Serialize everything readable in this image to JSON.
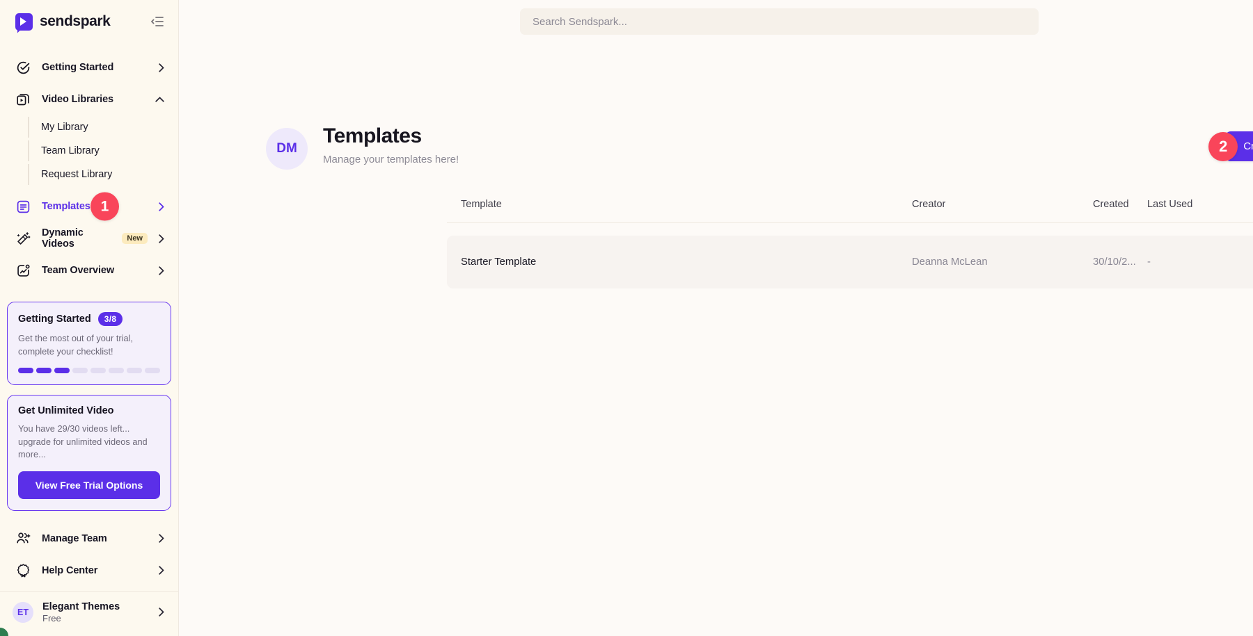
{
  "brand": {
    "name": "sendspark",
    "logo_icon": "sendspark-logo",
    "collapse_icon": "collapse-sidebar-icon"
  },
  "colors": {
    "accent": "#5b2fe8",
    "sidebar_bg": "#fdf9ef",
    "main_bg": "#fdfaf7",
    "badge_red": "#f9455a",
    "row_bg": "#f7f3f0",
    "new_badge_bg": "#fcebbe"
  },
  "search": {
    "placeholder": "Search Sendspark...",
    "value": ""
  },
  "sidebar": {
    "items": [
      {
        "label": "Getting Started",
        "icon": "check-circle-icon",
        "chevron": "chevron-right-icon"
      },
      {
        "label": "Video Libraries",
        "icon": "video-library-icon",
        "chevron": "chevron-up-icon"
      },
      {
        "label": "Templates",
        "icon": "document-lines-icon",
        "chevron": "chevron-right-icon",
        "badge": "1"
      },
      {
        "label": "Dynamic Videos",
        "icon": "magic-wand-icon",
        "chevron": "chevron-right-icon",
        "tag": "New"
      },
      {
        "label": "Team Overview",
        "icon": "chart-photo-icon",
        "chevron": "chevron-right-icon"
      }
    ],
    "sub_items": [
      {
        "label": "My Library"
      },
      {
        "label": "Team Library"
      },
      {
        "label": "Request Library"
      }
    ],
    "getting_started_card": {
      "title": "Getting Started",
      "pill": "3/8",
      "description": "Get the most out of your trial, complete your checklist!",
      "steps_total": 8,
      "steps_done": 3
    },
    "trial_card": {
      "title": "Get Unlimited Video",
      "description": "You have 29/30 videos left... upgrade for unlimited videos and more...",
      "button": "View Free Trial Options"
    },
    "bottom_items": [
      {
        "label": "Manage Team",
        "icon": "users-add-icon",
        "chevron": "chevron-right-icon"
      },
      {
        "label": "Help Center",
        "icon": "badge-help-icon",
        "chevron": "chevron-right-icon"
      }
    ],
    "user": {
      "initials": "ET",
      "name": "Elegant Themes",
      "plan": "Free",
      "chevron": "chevron-right-icon"
    }
  },
  "page": {
    "avatar_initials": "DM",
    "title": "Templates",
    "subtitle": "Manage your templates here!",
    "create_badge": "2",
    "create_button": "Create Template"
  },
  "table": {
    "columns": [
      "Template",
      "Creator",
      "Created",
      "Last Used"
    ],
    "rows": [
      {
        "template": "Starter Template",
        "creator": "Deanna McLean",
        "created": "30/10/2...",
        "last_used": "-"
      }
    ]
  },
  "widgets": {
    "tool_badge_icon": "user-search-icon",
    "chat_icon": "chat-bubble-icon"
  }
}
